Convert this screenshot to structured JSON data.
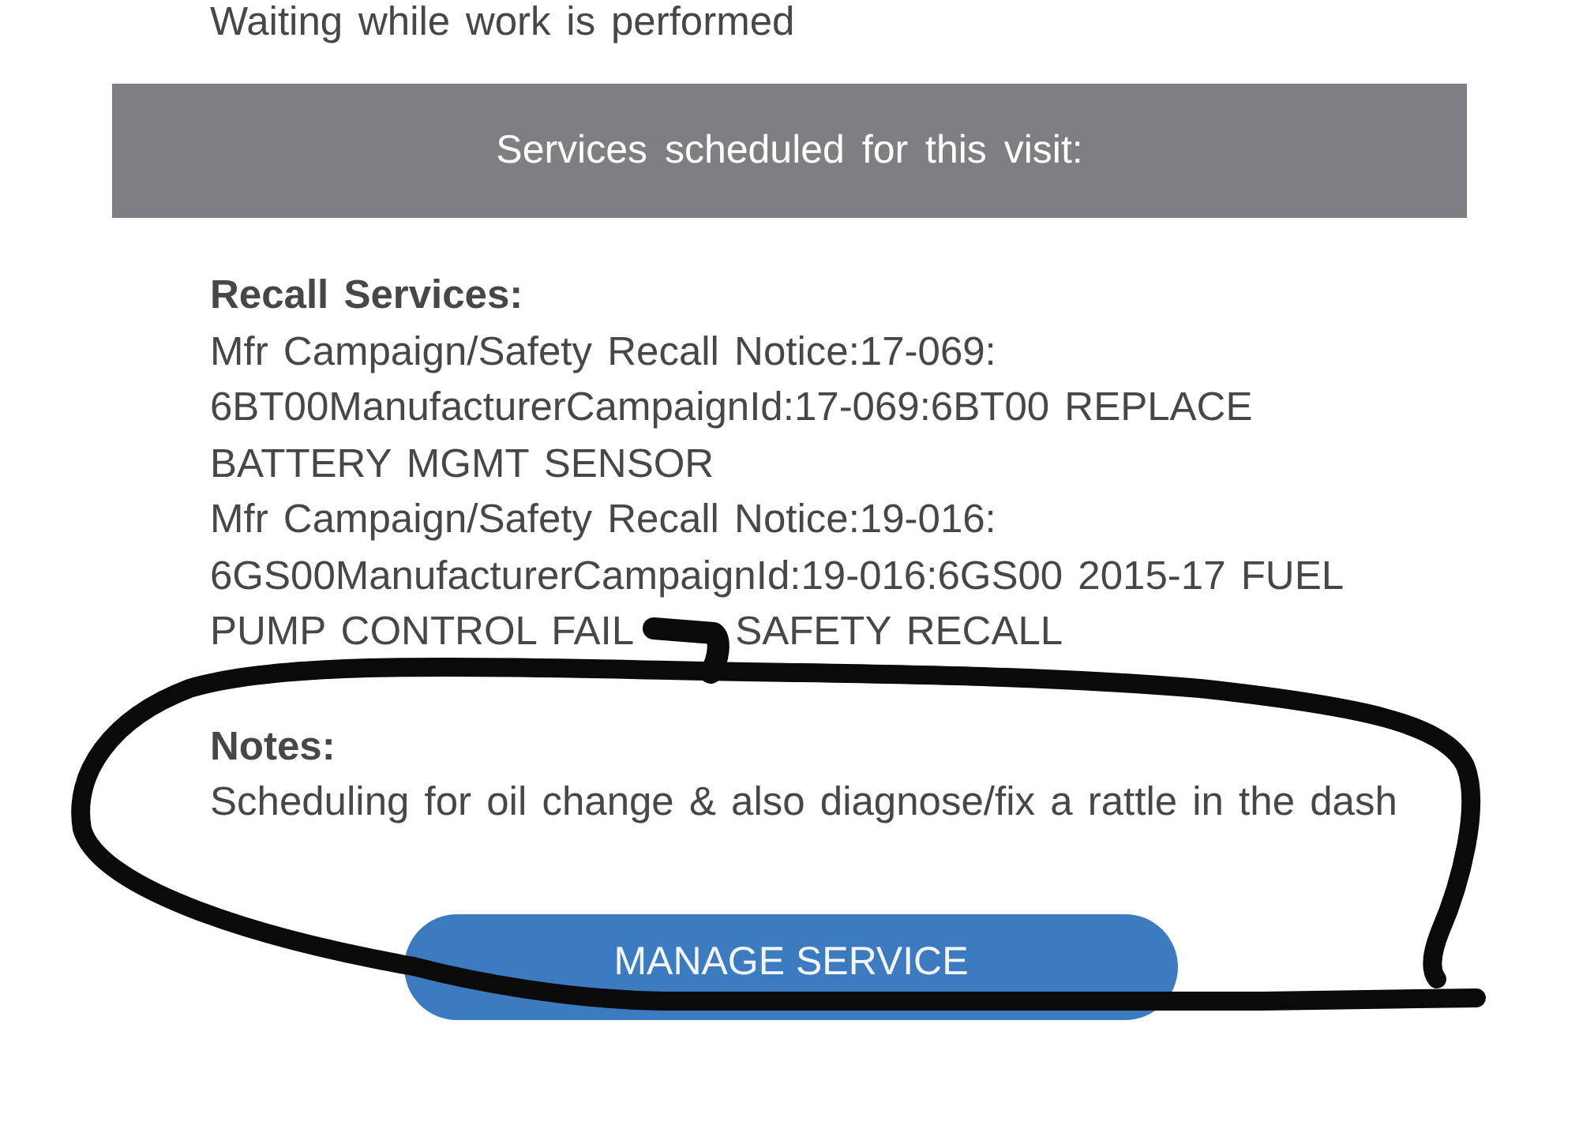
{
  "status_text": "Waiting while work is performed",
  "banner": {
    "title": "Services scheduled for this visit:"
  },
  "recall_services": {
    "heading": "Recall Services:",
    "items": [
      {
        "parts": [
          "Mfr Campaign/Safety Recall Notice:17-069: 6BT00ManufacturerCampaignId:17-069:6BT00 REPLACE BATTERY MGMT SENSOR"
        ]
      },
      {
        "parts": [
          "Mfr Campaign/Safety Recall Notice:19-016: 6GS00ManufacturerCampaignId:19-016:6GS00 2015-17 FUEL PUMP CONTROL FAIL",
          "SAFETY RECALL"
        ]
      }
    ]
  },
  "notes": {
    "heading": "Notes:",
    "text": "Scheduling for oil change & also diagnose/fix a rattle in the dash"
  },
  "button": {
    "label": "MANAGE SERVICE"
  }
}
